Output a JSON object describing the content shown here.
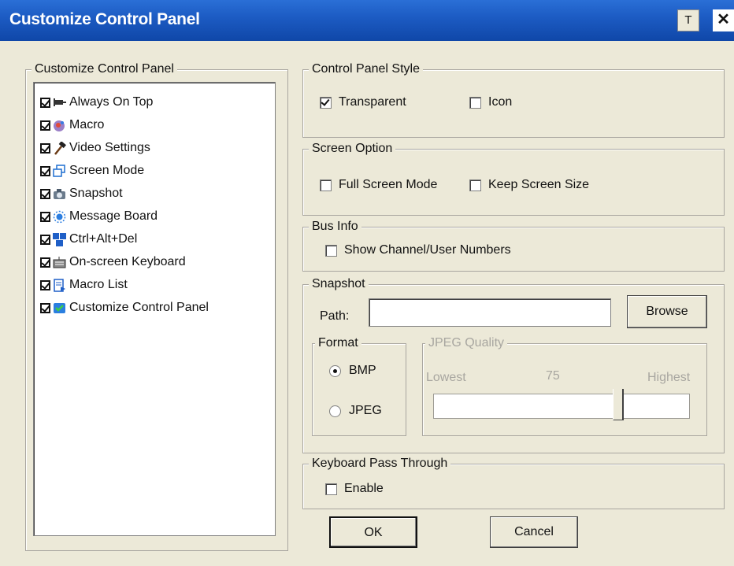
{
  "window": {
    "title": "Customize Control Panel",
    "pin_label": "T",
    "close_label": "✕"
  },
  "left_group": {
    "label": "Customize Control Panel",
    "items": [
      {
        "label": "Always On Top",
        "checked": true,
        "icon": "pin-icon"
      },
      {
        "label": "Macro",
        "checked": true,
        "icon": "macro-icon"
      },
      {
        "label": "Video Settings",
        "checked": true,
        "icon": "hammer-icon"
      },
      {
        "label": "Screen Mode",
        "checked": true,
        "icon": "screen-mode-icon"
      },
      {
        "label": "Snapshot",
        "checked": true,
        "icon": "camera-icon"
      },
      {
        "label": "Message Board",
        "checked": true,
        "icon": "message-board-icon"
      },
      {
        "label": "Ctrl+Alt+Del",
        "checked": true,
        "icon": "ctrl-alt-del-icon"
      },
      {
        "label": "On-screen Keyboard",
        "checked": true,
        "icon": "keyboard-icon"
      },
      {
        "label": "Macro List",
        "checked": true,
        "icon": "macro-list-icon"
      },
      {
        "label": "Customize Control Panel",
        "checked": true,
        "icon": "customize-icon"
      }
    ]
  },
  "style_group": {
    "label": "Control Panel Style",
    "transparent": {
      "label": "Transparent",
      "checked": true
    },
    "icon": {
      "label": "Icon",
      "checked": false
    }
  },
  "screen_group": {
    "label": "Screen Option",
    "full_screen": {
      "label": "Full Screen Mode",
      "checked": false
    },
    "keep_size": {
      "label": "Keep Screen Size",
      "checked": false
    }
  },
  "bus_group": {
    "label": "Bus Info",
    "show_numbers": {
      "label": "Show Channel/User Numbers",
      "checked": false
    }
  },
  "snapshot_group": {
    "label": "Snapshot",
    "path_label": "Path:",
    "path_value": "",
    "browse_label": "Browse",
    "format": {
      "label": "Format",
      "bmp": "BMP",
      "jpeg": "JPEG",
      "selected": "BMP"
    },
    "quality": {
      "label": "JPEG Quality",
      "lowest": "Lowest",
      "highest": "Highest",
      "value": "75",
      "fraction": 0.73
    }
  },
  "keyboard_group": {
    "label": "Keyboard Pass Through",
    "enable": {
      "label": "Enable",
      "checked": false
    }
  },
  "buttons": {
    "ok": "OK",
    "cancel": "Cancel"
  },
  "colors": {
    "titlebar": "#1d5cc4",
    "dialog_bg": "#ece9d8"
  }
}
